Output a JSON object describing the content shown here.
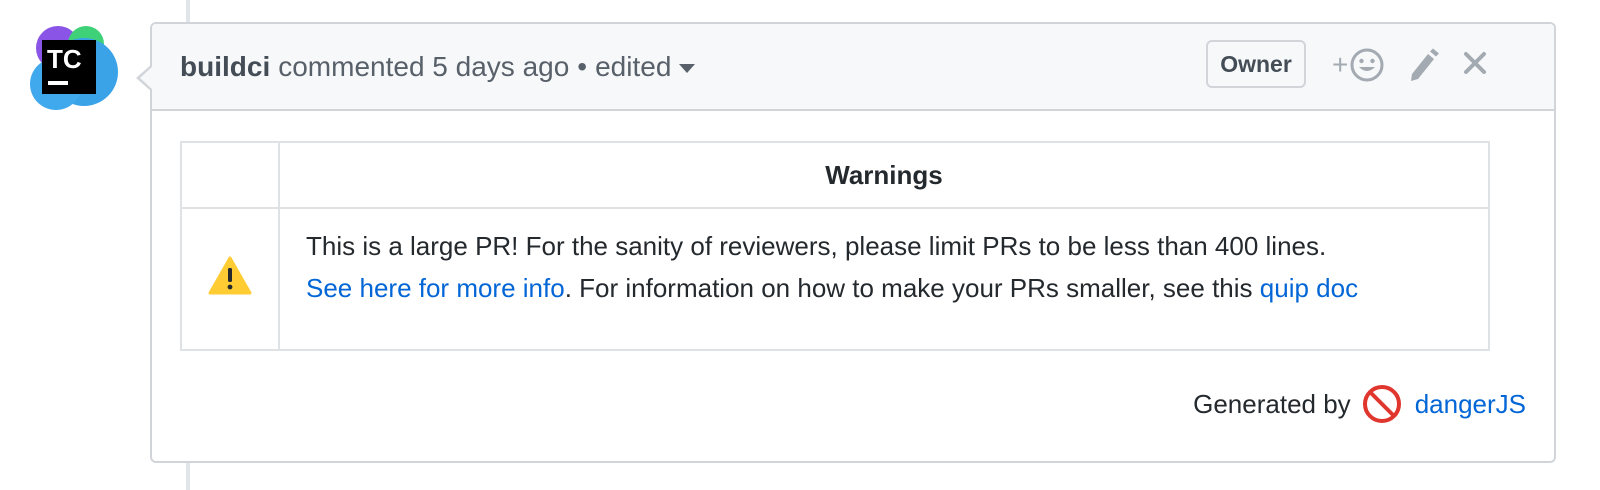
{
  "comment": {
    "author": "buildci",
    "action_text": "commented 5 days ago",
    "separator": "•",
    "edited_label": "edited",
    "badge": "Owner",
    "avatar_text": "TC",
    "icons": {
      "reaction": "add-reaction-icon",
      "edit": "pencil-icon",
      "close": "close-icon",
      "caret": "caret-down-icon",
      "warning": "warning-icon",
      "no_entry": "no-entry-icon"
    }
  },
  "table": {
    "header_blank": "",
    "header": "Warnings",
    "message": "This is a large PR! For the sanity of reviewers, please limit PRs to be less than 400 lines.",
    "link1": "See here for more info",
    "middle_text": ". For information on how to make your PRs smaller, see this",
    "link2": "quip doc"
  },
  "footer": {
    "generated_by": "Generated by",
    "link": "dangerJS"
  },
  "colors": {
    "link": "#0366d6",
    "border": "#d1d5da",
    "header_bg": "#f6f8fa",
    "warning": "#ffcc33",
    "no_entry": "#e0362e"
  }
}
